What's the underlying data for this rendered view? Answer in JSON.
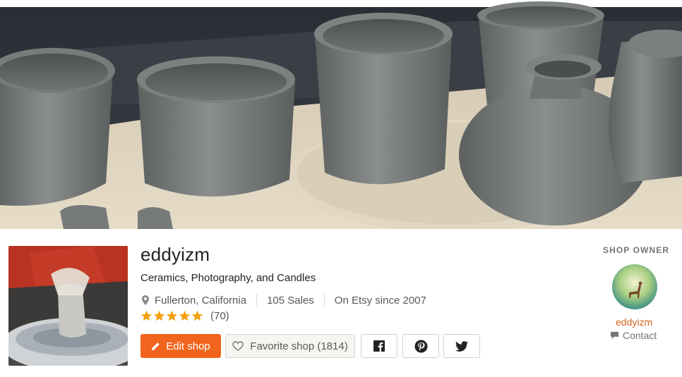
{
  "banner": {
    "alt_icon": "pottery-banner-photo"
  },
  "shop": {
    "name": "eddyizm",
    "title": "Ceramics, Photography, and Candles",
    "location": "Fullerton, California",
    "sales": "105 Sales",
    "since": "On Etsy since 2007",
    "rating": {
      "stars": 5,
      "max": 5,
      "count": "(70)"
    }
  },
  "actions": {
    "edit_label": "Edit shop",
    "favorite_label": "Favorite shop (1814)",
    "social": [
      "facebook-icon",
      "pinterest-icon",
      "twitter-icon"
    ]
  },
  "owner": {
    "heading": "SHOP OWNER",
    "name": "eddyizm",
    "contact_label": "Contact"
  },
  "colors": {
    "accent": "#f1641e",
    "star": "#f1a10e",
    "owner_link": "#d5641c"
  }
}
